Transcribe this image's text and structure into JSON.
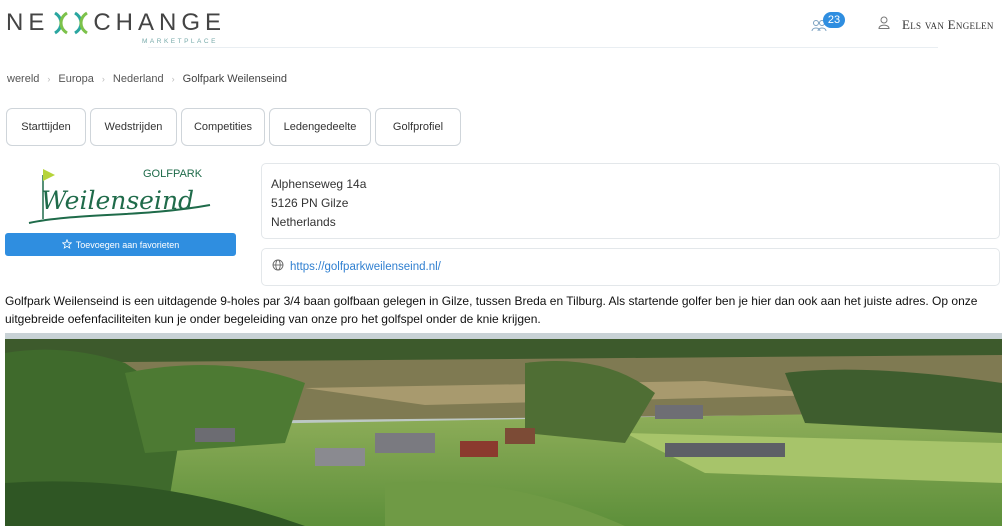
{
  "header": {
    "logo_text_left": "NE",
    "logo_text_right": "CHANGE",
    "logo_subtext": "MARKETPLACE",
    "notification_count": "23",
    "user_name": "Els van Engelen"
  },
  "breadcrumb": [
    {
      "label": "wereld"
    },
    {
      "label": "Europa"
    },
    {
      "label": "Nederland"
    },
    {
      "label": "Golfpark Weilenseind"
    }
  ],
  "tabs": [
    {
      "label": "Starttijden"
    },
    {
      "label": "Wedstrijden"
    },
    {
      "label": "Competities"
    },
    {
      "label": "Ledengedeelte"
    },
    {
      "label": "Golfprofiel"
    }
  ],
  "club": {
    "logo_top": "GOLFPARK",
    "logo_script": "Weilenseind",
    "favorite_label": "Toevoegen aan favorieten",
    "address": {
      "street": "Alphenseweg 14a",
      "postal_city": "5126 PN Gilze",
      "country": "Netherlands"
    },
    "website": "https://golfparkweilenseind.nl/",
    "description": "Golfpark Weilenseind is een uitdagende 9-holes par 3/4 baan golfbaan gelegen in Gilze, tussen Breda en Tilburg. Als startende golfer ben je hier dan ook aan het juiste adres. Op onze uitgebreide oefenfaciliteiten kun je onder begeleiding van onze pro het golfspel onder de knie krijgen."
  },
  "colors": {
    "accent": "#2f8ee0",
    "link": "#2f7fd0",
    "logo_green": "#1f6b4a",
    "flag": "#b6d43a"
  },
  "icons": {
    "notification": "people-icon",
    "user": "user-icon",
    "favorite": "star-icon",
    "website": "globe-icon"
  }
}
